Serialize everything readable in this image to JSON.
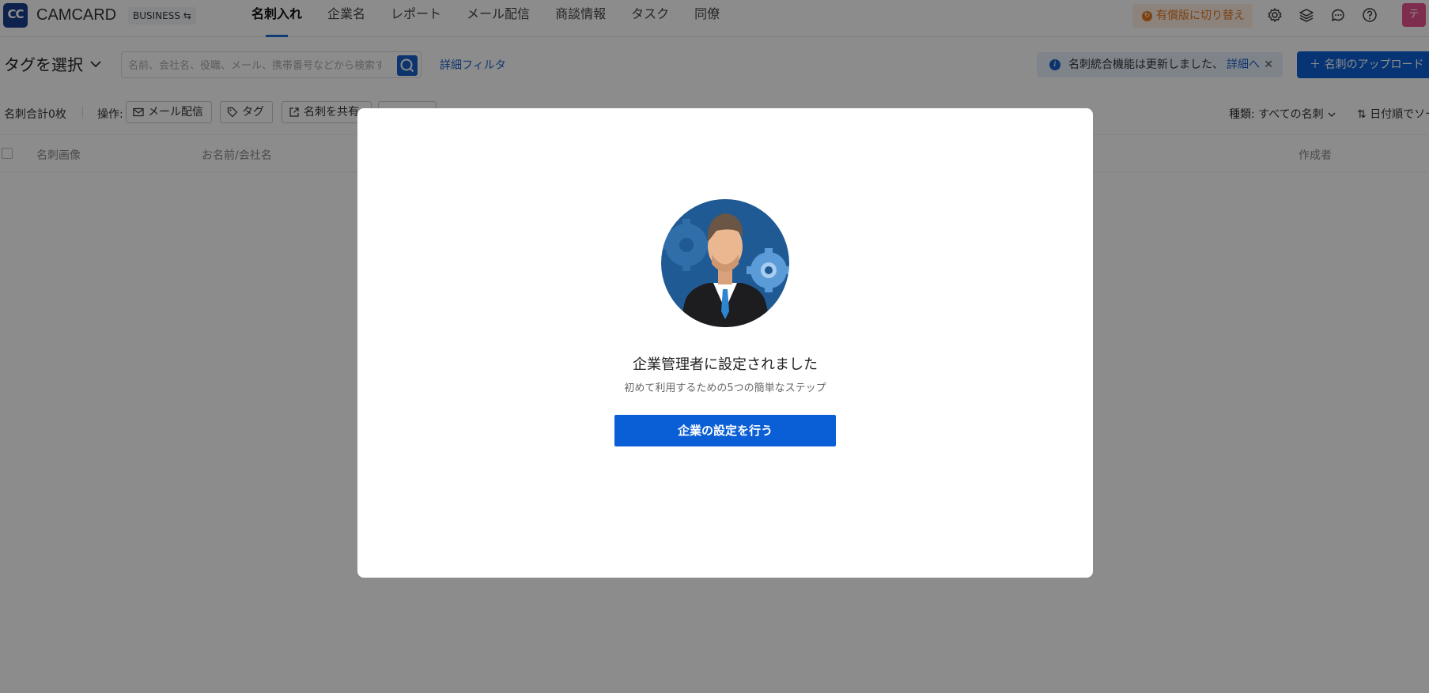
{
  "header": {
    "logo_text": "CC",
    "brand": "CAMCARD",
    "edition": "BUSINESS ⇆",
    "nav": [
      "名刺入れ",
      "企業名",
      "レポート",
      "メール配信",
      "商談情報",
      "タスク",
      "同僚"
    ],
    "active_nav": "名刺入れ",
    "upgrade_label": "有償版に切り替え",
    "avatar_text": "テ"
  },
  "toolbar": {
    "tag_select_label": "タグを選択",
    "search_placeholder": "名前、会社名、役職、メール、携帯番号などから検索す",
    "filter_link": "詳細フィルタ",
    "notice_text": "名刺統合機能は更新しました、",
    "notice_link": "詳細へ",
    "upload_label": "＋ 名刺のアップロード"
  },
  "operations": {
    "count": "名刺合計0枚",
    "label": "操作:",
    "buttons": [
      "メール配信",
      "タグ",
      "名刺を共有"
    ],
    "kind": "種類: すべての名刺",
    "sort": "日付順でソート"
  },
  "table": {
    "columns": [
      "名刺画像",
      "お名前/会社名",
      "作成者"
    ]
  },
  "modal": {
    "title": "企業管理者に設定されました",
    "subtitle": "初めて利用するための5つの簡単なステップ",
    "button": "企業の設定を行う"
  },
  "colors": {
    "primary": "#0b5fd6",
    "upgrade": "#e5781f",
    "avatar": "#e8538f"
  }
}
